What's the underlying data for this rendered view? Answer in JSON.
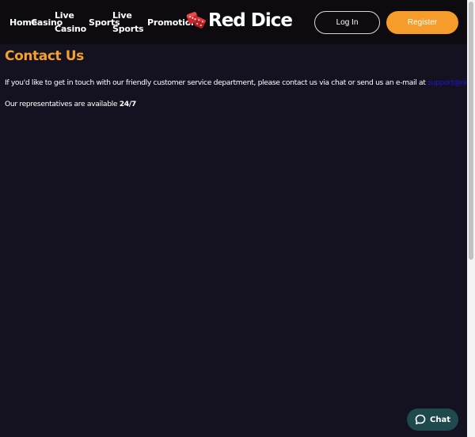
{
  "header": {
    "nav": [
      {
        "label": "Home"
      },
      {
        "label": "Casino"
      },
      {
        "line1": "Live",
        "line2": "Casino"
      },
      {
        "label": "Sports"
      },
      {
        "line1": "Live",
        "line2": "Sports"
      },
      {
        "label": "Promotions"
      }
    ],
    "logo_text": "Red Dice",
    "login_label": "Log In",
    "register_label": "Register"
  },
  "main": {
    "title": "Contact Us",
    "intro_text": "If you'd like to get in touch with our friendly customer service department, please contact us via chat or send us an e-mail at ",
    "email": "support@reddice.com",
    "intro_end": ".",
    "availability_text": "Our representatives are available ",
    "availability_value": "24/7"
  },
  "chat": {
    "label": "Chat",
    "icon": "chat-bubble-icon"
  },
  "colors": {
    "accent": "#f5a02c",
    "register_bg": "#f59c2a",
    "header_bg": "#0e0b10",
    "page_bg": "#141120",
    "link": "#1a1ad6",
    "chat_bg": "#1e4a4e"
  }
}
